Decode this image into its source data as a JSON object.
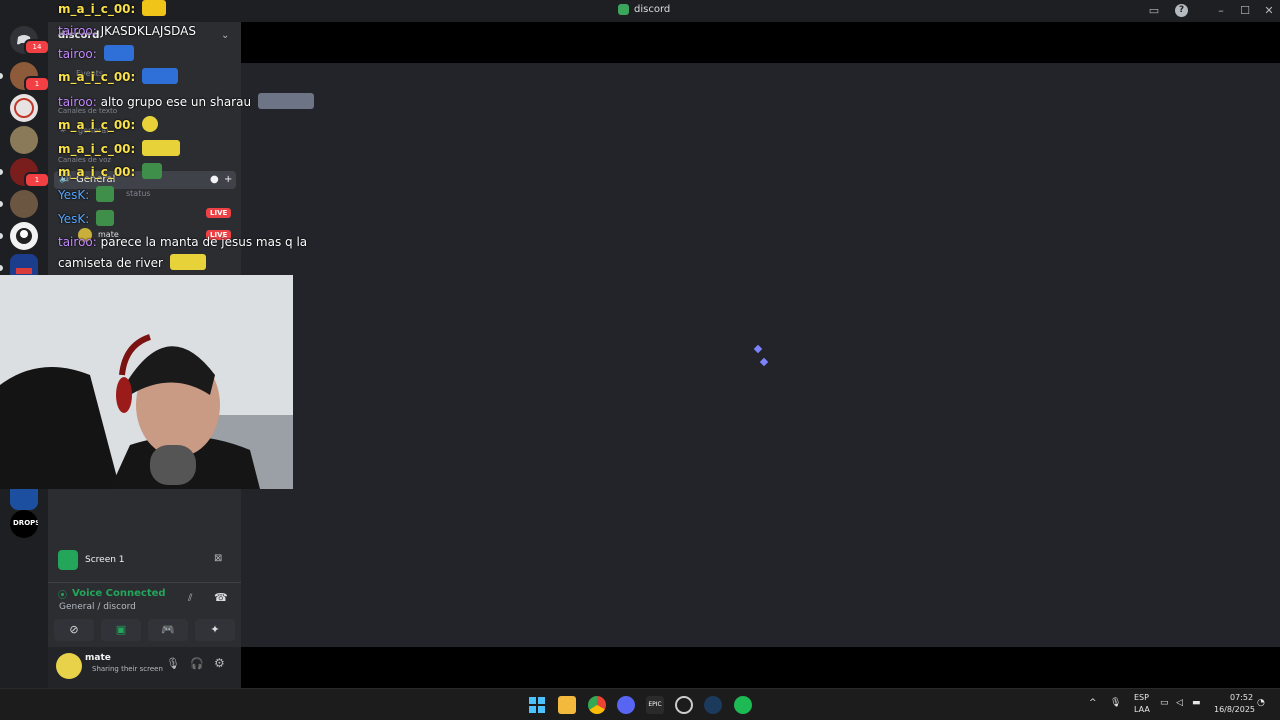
{
  "window": {
    "title": "discord",
    "buttons": {
      "minimize": "–",
      "maximize": "☐",
      "close": "✕"
    }
  },
  "servers": [
    {
      "name": "direct-messages",
      "badge": "14"
    },
    {
      "name": "server-2",
      "badge": "1"
    },
    {
      "name": "server-3",
      "badge": ""
    },
    {
      "name": "server-4",
      "badge": ""
    },
    {
      "name": "server-5",
      "badge": "1"
    },
    {
      "name": "server-6",
      "badge": ""
    },
    {
      "name": "server-7",
      "badge": ""
    },
    {
      "name": "server-8",
      "badge": ""
    },
    {
      "name": "server-9",
      "badge": ""
    },
    {
      "name": "drops-server",
      "label": "DROPS"
    }
  ],
  "sidebar": {
    "server_name": "discord",
    "events_label": "Events",
    "text_channels_label": "Canales de texto",
    "text_channel": "general",
    "voice_channels_label": "Canales de voz",
    "voice_channel": "General",
    "status_text": "status",
    "voice_user": "mate",
    "live_label": "LIVE",
    "live_label_2": "LIVE"
  },
  "chat": [
    {
      "nick": "m_a_i_c_00:",
      "text": "",
      "nick_color": "yellow"
    },
    {
      "nick": "tairoo:",
      "text": "JKASDKLAJSDAS",
      "nick_color": "purple"
    },
    {
      "nick": "tairoo:",
      "text": "",
      "nick_color": "purple"
    },
    {
      "nick": "m_a_i_c_00:",
      "text": "",
      "nick_color": "yellow"
    },
    {
      "nick": "tairoo:",
      "text": "alto grupo ese un sharau",
      "nick_color": "purple"
    },
    {
      "nick": "m_a_i_c_00:",
      "text": "",
      "nick_color": "yellow"
    },
    {
      "nick": "m_a_i_c_00:",
      "text": "",
      "nick_color": "yellow"
    },
    {
      "nick": "m_a_i_c_00:",
      "text": "",
      "nick_color": "yellow"
    },
    {
      "nick": "YesK:",
      "text": "",
      "nick_color": "blue"
    },
    {
      "nick": "YesK:",
      "text": "",
      "nick_color": "blue"
    },
    {
      "nick": "tairoo:",
      "text": "parece la manta de jesus mas q la",
      "nick_color": "purple"
    },
    {
      "nick": "",
      "text": "camiseta de river",
      "nick_color": "purple"
    }
  ],
  "stream_panel": {
    "screen_label": "Screen 1"
  },
  "voice": {
    "status": "Voice Connected",
    "location": "General / discord"
  },
  "user": {
    "name": "mate",
    "activity": "Sharing their screen"
  },
  "taskbar": {
    "apps": [
      "start-icon",
      "file-explorer-icon",
      "chrome-icon",
      "discord-icon",
      "epic-games-icon",
      "obs-icon",
      "steam-icon",
      "spotify-icon"
    ],
    "lang_top": "ESP",
    "lang_bottom": "LAA",
    "time": "07:52",
    "date": "16/8/2025"
  },
  "colors": {
    "accent": "#5865f2",
    "voice_green": "#23a55a",
    "live_red": "#ed4245",
    "loader": "#7c83ff"
  }
}
